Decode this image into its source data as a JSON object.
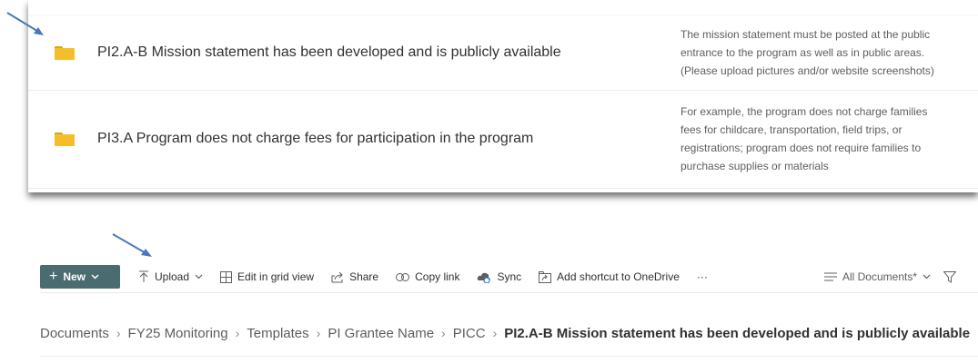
{
  "top_rows": [
    {
      "name": "PI2.A-B Mission statement has been developed and is publicly available",
      "description": "The mission statement must be posted at the public\nentrance to the program as well as in public areas.\n(Please upload pictures and/or website screenshots)",
      "icon": "folder-icon"
    },
    {
      "name": "PI3.A  Program does not charge fees for participation in the program",
      "description": "For example, the program does not charge families\nfees for childcare, transportation, field trips, or\nregistrations; program does not require families to\npurchase supplies or materials",
      "icon": "folder-icon"
    }
  ],
  "command_bar": {
    "new_label": "New",
    "upload_label": "Upload",
    "edit_grid_label": "Edit in grid view",
    "share_label": "Share",
    "copy_link_label": "Copy link",
    "sync_label": "Sync",
    "add_shortcut_label": "Add shortcut to OneDrive",
    "more_label": "···",
    "view_label": "All Documents*"
  },
  "breadcrumb": {
    "items": [
      "Documents",
      "FY25 Monitoring",
      "Templates",
      "PI Grantee Name",
      "PICC"
    ],
    "current": "PI2.A-B Mission statement has been developed and is publicly available",
    "separator": "›"
  },
  "colors": {
    "new_button_bg": "#4a6b70",
    "folder_yellow": "#f4bd2a",
    "annotation_arrow": "#4a78b8"
  }
}
